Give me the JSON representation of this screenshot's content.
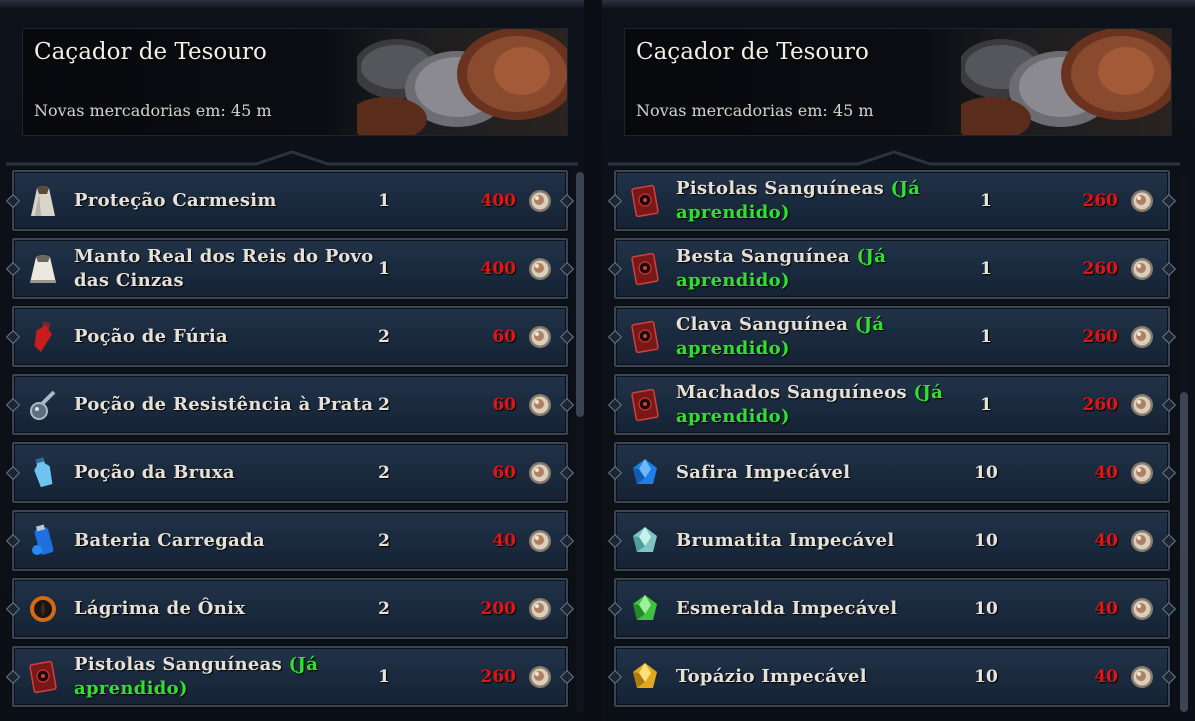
{
  "panels": [
    {
      "title": "Caçador de Tesouro",
      "subtitle": "Novas mercadorias em: 45 m",
      "items": [
        {
          "name": "Proteção Carmesim",
          "learned": "",
          "qty": "1",
          "price": "400",
          "icon": "crimson-cloak-icon"
        },
        {
          "name": "Manto Real dos Reis do Povo das Cinzas",
          "learned": "",
          "qty": "1",
          "price": "400",
          "icon": "royal-cloak-icon"
        },
        {
          "name": "Poção de Fúria",
          "learned": "",
          "qty": "2",
          "price": "60",
          "icon": "fury-potion-icon"
        },
        {
          "name": "Poção de Resistência à Prata",
          "learned": "",
          "qty": "2",
          "price": "60",
          "icon": "silver-potion-icon"
        },
        {
          "name": "Poção da Bruxa",
          "learned": "",
          "qty": "2",
          "price": "60",
          "icon": "witch-potion-icon"
        },
        {
          "name": "Bateria Carregada",
          "learned": "",
          "qty": "2",
          "price": "40",
          "icon": "battery-icon"
        },
        {
          "name": "Lágrima de Ônix",
          "learned": "",
          "qty": "2",
          "price": "200",
          "icon": "onyx-tear-icon"
        },
        {
          "name": "Pistolas Sanguíneas",
          "learned": "(Já aprendido)",
          "qty": "1",
          "price": "260",
          "icon": "recipe-book-icon"
        }
      ]
    },
    {
      "title": "Caçador de Tesouro",
      "subtitle": "Novas mercadorias em: 45 m",
      "items": [
        {
          "name": "Pistolas Sanguíneas",
          "learned": "(Já aprendido)",
          "qty": "1",
          "price": "260",
          "icon": "recipe-book-icon"
        },
        {
          "name": "Besta Sanguínea",
          "learned": "(Já aprendido)",
          "qty": "1",
          "price": "260",
          "icon": "recipe-book-icon"
        },
        {
          "name": "Clava Sanguínea",
          "learned": "(Já aprendido)",
          "qty": "1",
          "price": "260",
          "icon": "recipe-book-icon"
        },
        {
          "name": "Machados Sanguíneos",
          "learned": "(Já aprendido)",
          "qty": "1",
          "price": "260",
          "icon": "recipe-book-icon"
        },
        {
          "name": "Safira Impecável",
          "learned": "",
          "qty": "10",
          "price": "40",
          "icon": "sapphire-icon"
        },
        {
          "name": "Brumatita Impecável",
          "learned": "",
          "qty": "10",
          "price": "40",
          "icon": "mistite-icon"
        },
        {
          "name": "Esmeralda Impecável",
          "learned": "",
          "qty": "10",
          "price": "40",
          "icon": "emerald-icon"
        },
        {
          "name": "Topázio Impecável",
          "learned": "",
          "qty": "10",
          "price": "40",
          "icon": "topaz-icon"
        }
      ]
    }
  ],
  "colors": {
    "price": "#e11515",
    "learned": "#2fe02f",
    "row_bg": "#1b2b3f"
  },
  "currency_icon": "coin-icon"
}
